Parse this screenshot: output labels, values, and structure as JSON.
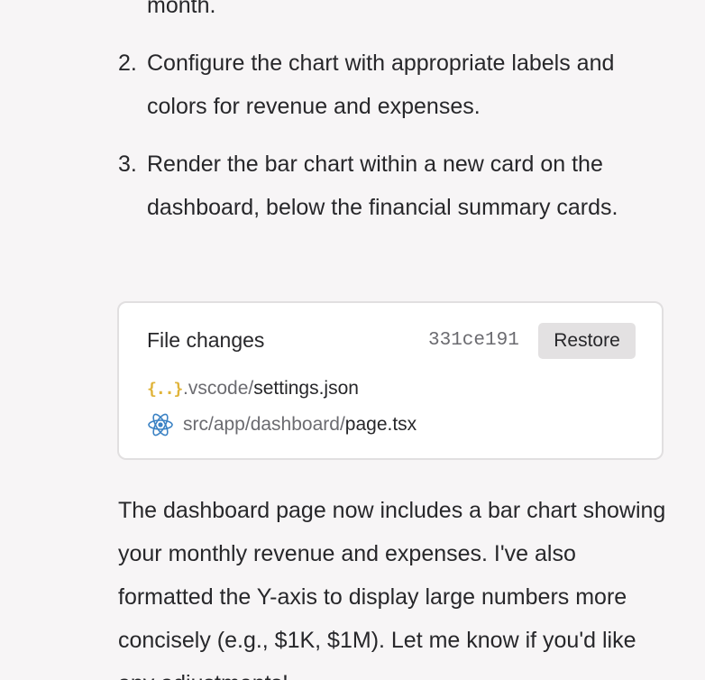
{
  "steps": [
    {
      "num": "",
      "text": "month."
    },
    {
      "num": "2.",
      "text": "Configure the chart with appropriate labels and colors for revenue and expenses."
    },
    {
      "num": "3.",
      "text": "Render the bar chart within a new card on the dashboard, below the financial summary cards."
    }
  ],
  "file_changes": {
    "title": "File changes",
    "commit": "331ce191",
    "restore_label": "Restore",
    "files": [
      {
        "dir": ".vscode/",
        "name": "settings.json",
        "icon": "json-icon"
      },
      {
        "dir": "src/app/dashboard/",
        "name": "page.tsx",
        "icon": "react-icon"
      }
    ]
  },
  "summary": "The dashboard page now includes a bar chart showing your monthly revenue and expenses. I've also formatted the Y-axis to display large numbers more concisely (e.g., $1K, $1M). Let me know if you'd like any adjustments!",
  "colors": {
    "json_icon": "#e0b43a",
    "react_icon": "#3b82c4",
    "background": "#f7f5f6"
  }
}
